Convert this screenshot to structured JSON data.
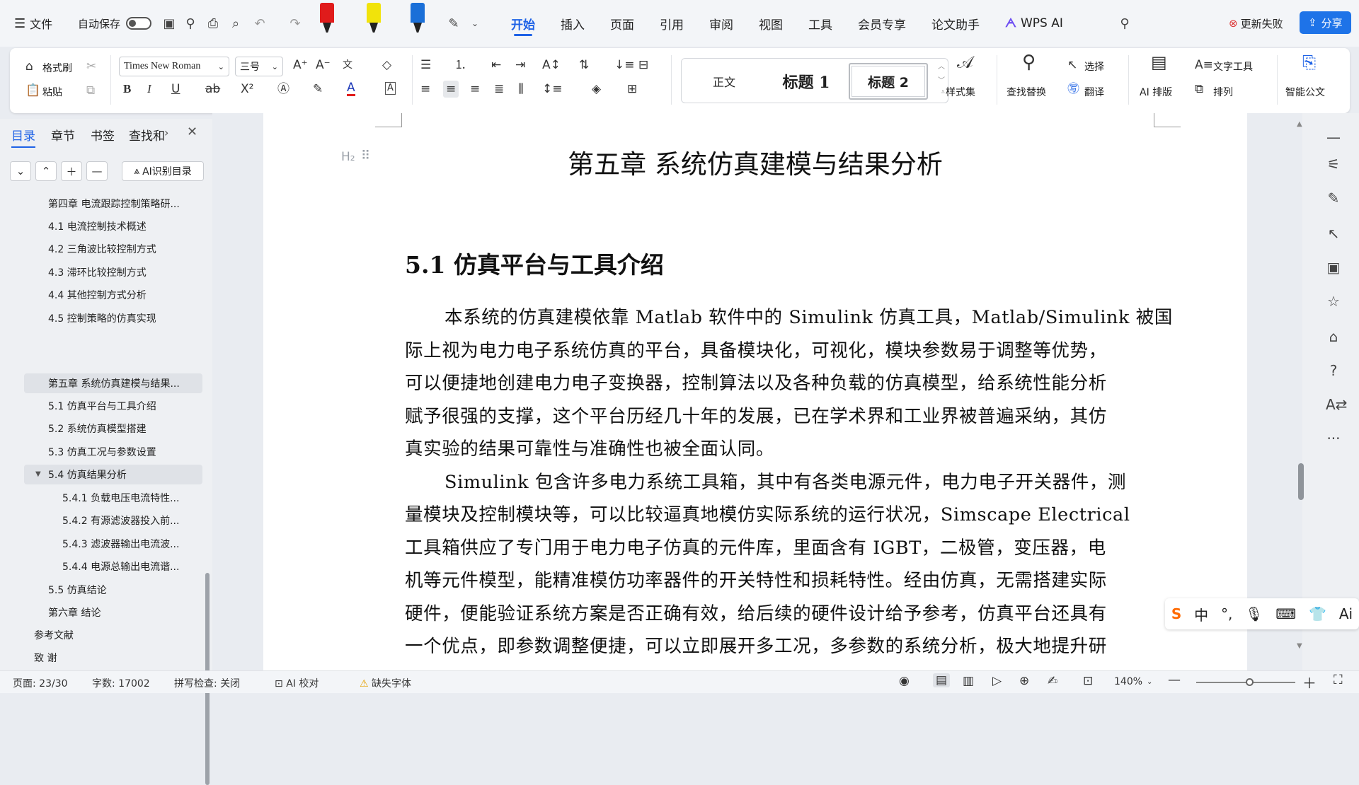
{
  "topbar": {
    "file_label": "文件",
    "autosave_label": "自动保存",
    "menus": [
      "开始",
      "插入",
      "页面",
      "引用",
      "审阅",
      "视图",
      "工具",
      "会员专享",
      "论文助手"
    ],
    "wps_ai": "WPS AI",
    "update_fail": "更新失败",
    "share": "分享"
  },
  "ribbon": {
    "format_painter": "格式刷",
    "paste": "粘贴",
    "font_name": "Times New Roman",
    "font_size": "三号",
    "styles": {
      "normal": "正文",
      "h1": "标题 1",
      "h2": "标题 2"
    },
    "style_set": "样式集",
    "find_replace": "查找替换",
    "select": "选择",
    "translate": "翻译",
    "ai_layout": "AI 排版",
    "text_tools": "文字工具",
    "arrange": "排列",
    "smart_doc": "智能公文"
  },
  "left_panel": {
    "tabs": [
      "目录",
      "章节",
      "书签",
      "查找和"
    ],
    "ai_toc": "AI识别目录",
    "toc": [
      {
        "text": "第四章  电流跟踪控制策略研...",
        "level": 1
      },
      {
        "text": "4.1  电流控制技术概述",
        "level": 2
      },
      {
        "text": "4.2  三角波比较控制方式",
        "level": 2
      },
      {
        "text": "4.3  滞环比较控制方式",
        "level": 2
      },
      {
        "text": "4.4  其他控制方式分析",
        "level": 2
      },
      {
        "text": "4.5  控制策略的仿真实现",
        "level": 2
      },
      {
        "text": "第五章  系统仿真建模与结果...",
        "level": 1
      },
      {
        "text": "5.1  仿真平台与工具介绍",
        "level": 2
      },
      {
        "text": "5.2  系统仿真模型搭建",
        "level": 2
      },
      {
        "text": "5.3  仿真工况与参数设置",
        "level": 2
      },
      {
        "text": "5.4  仿真结果分析",
        "level": 2
      },
      {
        "text": "5.4.1  负载电压电流特性...",
        "level": 3
      },
      {
        "text": "5.4.2  有源滤波器投入前...",
        "level": 3
      },
      {
        "text": "5.4.3  滤波器输出电流波...",
        "level": 3
      },
      {
        "text": "5.4.4  电源总输出电流谐...",
        "level": 3
      },
      {
        "text": "5.5  仿真结论",
        "level": 2
      },
      {
        "text": "第六章  结论",
        "level": 1
      },
      {
        "text": "参考文献",
        "level": 0
      },
      {
        "text": "致    谢",
        "level": 0
      }
    ]
  },
  "document": {
    "heading_marker": "H₂",
    "chapter_title": "第五章  系统仿真建模与结果分析",
    "section_title": "5.1  仿真平台与工具介绍",
    "lines": [
      "本系统的仿真建模依靠 Matlab 软件中的 Simulink 仿真工具，Matlab/Simulink 被国",
      "际上视为电力电子系统仿真的平台，具备模块化，可视化，模块参数易于调整等优势，",
      "可以便捷地创建电力电子变换器，控制算法以及各种负载的仿真模型，给系统性能分析",
      "赋予很强的支撑，这个平台历经几十年的发展，已在学术界和工业界被普遍采纳，其仿",
      "真实验的结果可靠性与准确性也被全面认同。",
      "Simulink 包含许多电力系统工具箱，其中有各类电源元件，电力电子开关器件，测",
      "量模块及控制模块等，可以比较逼真地模仿实际系统的运行状况，Simscape Electrical",
      "工具箱供应了专门用于电力电子仿真的元件库，里面含有 IGBT，二极管，变压器，电",
      "机等元件模型，能精准模仿功率器件的开关特性和损耗特性。经由仿真，无需搭建实际",
      "硬件，便能验证系统方案是否正确有效，给后续的硬件设计给予参考，仿真平台还具有",
      "一个优点，即参数调整便捷，可以立即展开多工况，多参数的系统分析，极大地提升研"
    ]
  },
  "ime": {
    "lang": "中",
    "ai": "Ai"
  },
  "statusbar": {
    "page": "页面: 23/30",
    "words": "字数: 17002",
    "spell": "拼写检查: 关闭",
    "ai_proof": "AI 校对",
    "missing_font": "缺失字体",
    "zoom": "140%"
  }
}
